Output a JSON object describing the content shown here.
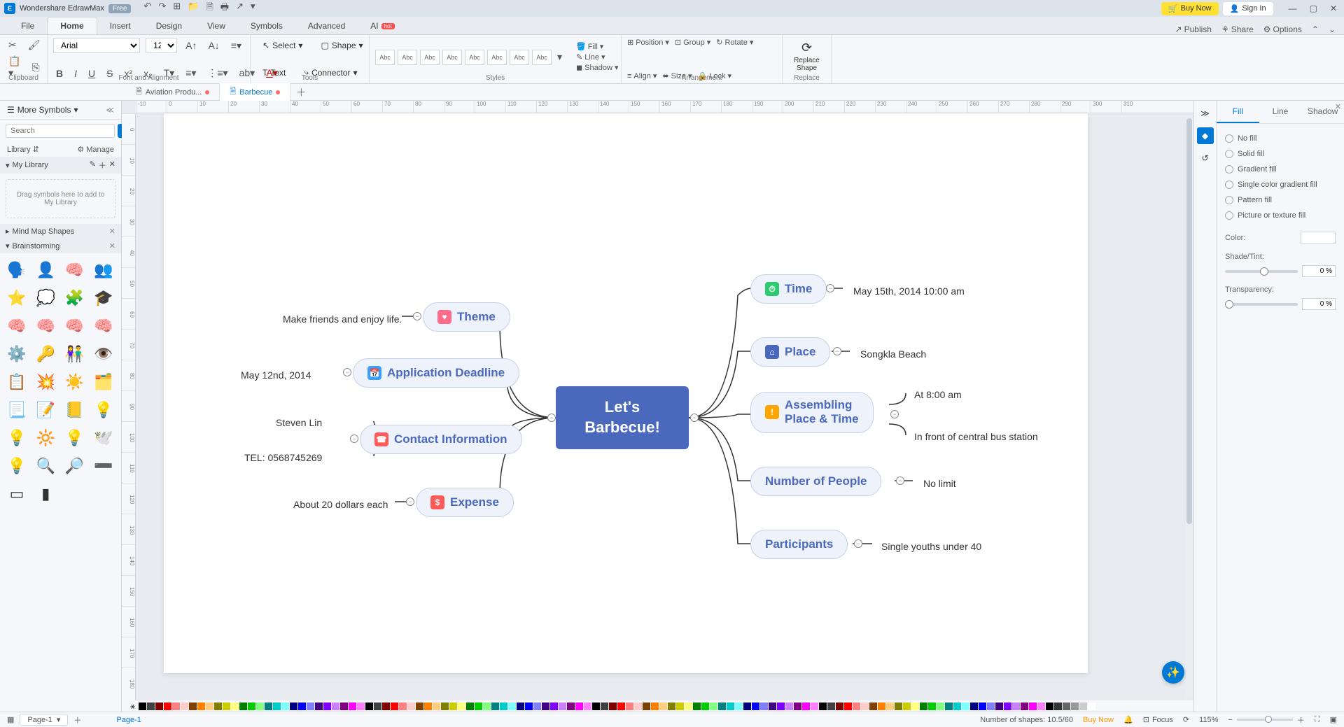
{
  "app": {
    "title": "Wondershare EdrawMax",
    "free_badge": "Free"
  },
  "titlebar": {
    "buy_now": "Buy Now",
    "sign_in": "Sign In"
  },
  "menu": {
    "tabs": [
      "File",
      "Home",
      "Insert",
      "Design",
      "View",
      "Symbols",
      "Advanced",
      "AI"
    ],
    "active": 1,
    "hot": "hot",
    "right": {
      "publish": "Publish",
      "share": "Share",
      "options": "Options"
    }
  },
  "ribbon": {
    "clipboard_label": "Clipboard",
    "font_label": "Font and Alignment",
    "font_name": "Arial",
    "font_size": "12",
    "tools_label": "Tools",
    "select": "Select",
    "shape": "Shape",
    "text": "Text",
    "connector": "Connector",
    "styles_label": "Styles",
    "style_text": "Abc",
    "fill": "Fill",
    "line": "Line",
    "shadow": "Shadow",
    "arrangement_label": "Arrangement",
    "position": "Position",
    "group": "Group",
    "rotate": "Rotate",
    "align": "Align",
    "size": "Size",
    "lock": "Lock",
    "replace_label": "Replace",
    "replace_shape": "Replace\nShape"
  },
  "doctabs": {
    "tabs": [
      {
        "label": "Aviation Produ...",
        "modified": true,
        "active": false
      },
      {
        "label": "Barbecue",
        "modified": true,
        "active": true
      }
    ]
  },
  "sidebar": {
    "title": "More Symbols",
    "search_placeholder": "Search",
    "search_btn": "Search",
    "library": "Library",
    "manage": "Manage",
    "mylib": "My Library",
    "mylib_drop": "Drag symbols here to add to My Library",
    "sections": [
      "Mind Map Shapes",
      "Brainstorming"
    ]
  },
  "ruler_h": [
    "-10",
    "0",
    "10",
    "20",
    "30",
    "40",
    "50",
    "60",
    "70",
    "80",
    "90",
    "100",
    "110",
    "120",
    "130",
    "140",
    "150",
    "160",
    "170",
    "180",
    "190",
    "200",
    "210",
    "220",
    "230",
    "240",
    "250",
    "260",
    "270",
    "280",
    "290",
    "300",
    "310"
  ],
  "ruler_v": [
    "0",
    "10",
    "20",
    "30",
    "40",
    "50",
    "60",
    "70",
    "80",
    "90",
    "100",
    "110",
    "120",
    "130",
    "140",
    "150",
    "160",
    "170",
    "180"
  ],
  "mindmap": {
    "center": "Let's\nBarbecue!",
    "left": [
      {
        "label": "Theme",
        "icon_bg": "#ff6b8a",
        "leaves": [
          "Make friends and enjoy life."
        ]
      },
      {
        "label": "Application Deadline",
        "icon_bg": "#3aa0ff",
        "leaves": [
          "May 12nd, 2014"
        ]
      },
      {
        "label": "Contact Information",
        "icon_bg": "#ff5a5a",
        "leaves": [
          "Steven Lin",
          "TEL: 0568745269"
        ]
      },
      {
        "label": "Expense",
        "icon_bg": "#ff5a5a",
        "leaves": [
          "About 20 dollars each"
        ]
      }
    ],
    "right": [
      {
        "label": "Time",
        "icon_bg": "#2ecc71",
        "leaves": [
          "May 15th, 2014    10:00 am"
        ]
      },
      {
        "label": "Place",
        "icon_bg": "#4a69bd",
        "leaves": [
          "Songkla Beach"
        ]
      },
      {
        "label": "Assembling\nPlace & Time",
        "icon_bg": "#ffa502",
        "leaves": [
          "At 8:00 am",
          "In front of central bus station"
        ]
      },
      {
        "label": "Number of People",
        "icon_bg": "",
        "leaves": [
          "No limit"
        ]
      },
      {
        "label": "Participants",
        "icon_bg": "",
        "leaves": [
          "Single youths under 40"
        ]
      }
    ]
  },
  "rightpanel": {
    "tabs": [
      "Fill",
      "Line",
      "Shadow"
    ],
    "active": 0,
    "options": [
      "No fill",
      "Solid fill",
      "Gradient fill",
      "Single color gradient fill",
      "Pattern fill",
      "Picture or texture fill"
    ],
    "color_label": "Color:",
    "shade_label": "Shade/Tint:",
    "shade_val": "0 %",
    "transp_label": "Transparency:",
    "transp_val": "0 %"
  },
  "colorbar": [
    "#000",
    "#800000",
    "#f00",
    "#f88",
    "#fcc",
    "#fa0",
    "#fc8",
    "#0a0",
    "#5c5",
    "#0cc",
    "#08f",
    "#88f",
    "#80f",
    "#f0f",
    "#888",
    "#ccc"
  ],
  "status": {
    "page_selector": "Page-1",
    "page_tab": "Page-1",
    "shapes": "Number of shapes: 10.5/60",
    "buy_now": "Buy Now",
    "focus": "Focus",
    "zoom": "115%"
  }
}
